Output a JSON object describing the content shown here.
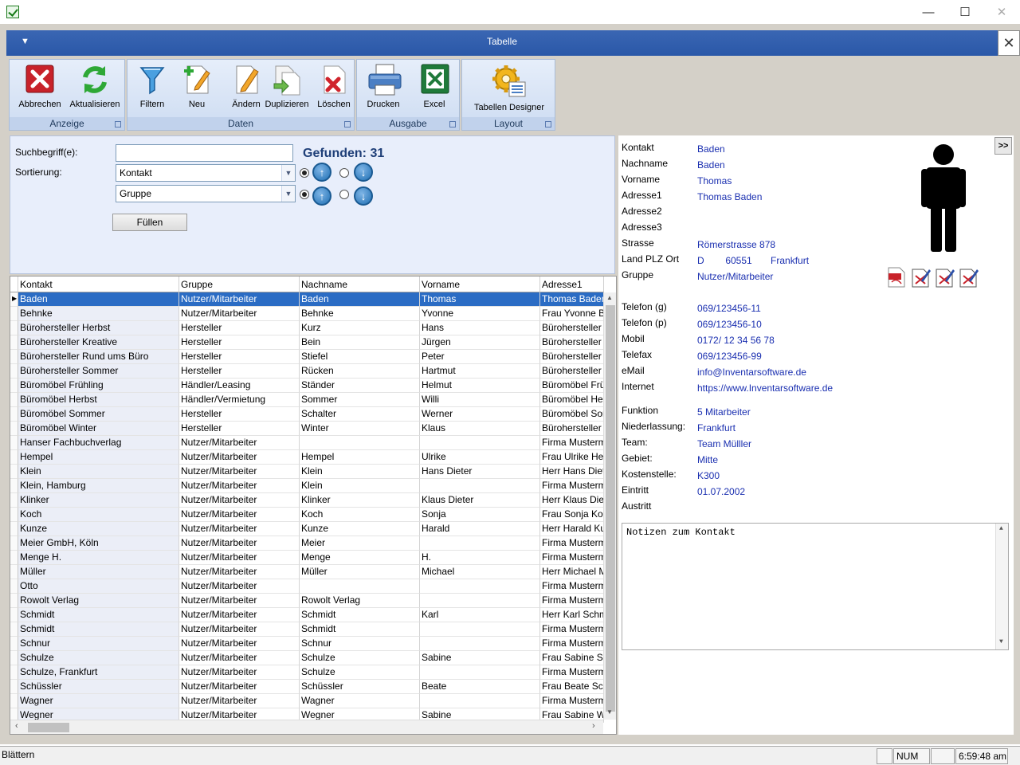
{
  "window": {
    "minimize": "—",
    "maximize": "☐",
    "close": "✕"
  },
  "inner": {
    "title": "Tabelle",
    "menu_glyph": "▼",
    "close_glyph": "✕"
  },
  "ribbon": {
    "buttons": {
      "abbrechen": "Abbrechen",
      "aktualisieren": "Aktualisieren",
      "filtern": "Filtern",
      "neu": "Neu",
      "aendern": "Ändern",
      "duplizieren": "Duplizieren",
      "loeschen": "Löschen",
      "drucken": "Drucken",
      "excel": "Excel",
      "designer": "Tabellen Designer"
    },
    "groups": {
      "anzeige": "Anzeige",
      "daten": "Daten",
      "ausgabe": "Ausgabe",
      "layout": "Layout"
    }
  },
  "search": {
    "label_search": "Suchbegriff(e):",
    "label_sort": "Sortierung:",
    "search_value": "",
    "sort1": "Kontakt",
    "sort2": "Gruppe",
    "found": "Gefunden: 31",
    "fill_button": "Füllen"
  },
  "grid": {
    "columns": [
      "Kontakt",
      "Gruppe",
      "Nachname",
      "Vorname",
      "Adresse1"
    ],
    "rows": [
      [
        "Baden",
        "Nutzer/Mitarbeiter",
        "Baden",
        "Thomas",
        "Thomas Baden"
      ],
      [
        "Behnke",
        "Nutzer/Mitarbeiter",
        "Behnke",
        "Yvonne",
        "Frau Yvonne Behnke"
      ],
      [
        "Bürohersteller Herbst",
        "Hersteller",
        "Kurz",
        "Hans",
        "Bürohersteller Herbst"
      ],
      [
        "Bürohersteller Kreative",
        "Hersteller",
        "Bein",
        "Jürgen",
        "Bürohersteller Kreative"
      ],
      [
        "Bürohersteller Rund ums Büro",
        "Hersteller",
        "Stiefel",
        "Peter",
        "Bürohersteller Rund ums Büro"
      ],
      [
        "Bürohersteller Sommer",
        "Hersteller",
        "Rücken",
        "Hartmut",
        "Bürohersteller Sommer"
      ],
      [
        "Büromöbel Frühling",
        "Händler/Leasing",
        "Ständer",
        "Helmut",
        "Büromöbel Frühling"
      ],
      [
        "Büromöbel Herbst",
        "Händler/Vermietung",
        "Sommer",
        "Willi",
        "Büromöbel Herbst"
      ],
      [
        "Büromöbel Sommer",
        "Hersteller",
        "Schalter",
        "Werner",
        "Büromöbel Sommer"
      ],
      [
        "Büromöbel Winter",
        "Hersteller",
        "Winter",
        "Klaus",
        "Bürohersteller Winter"
      ],
      [
        "Hanser Fachbuchverlag",
        "Nutzer/Mitarbeiter",
        "",
        "",
        "Firma Mustermann"
      ],
      [
        "Hempel",
        "Nutzer/Mitarbeiter",
        "Hempel",
        "Ulrike",
        "Frau Ulrike Hempel"
      ],
      [
        "Klein",
        "Nutzer/Mitarbeiter",
        "Klein",
        "Hans Dieter",
        "Herr Hans Dieter Klein"
      ],
      [
        "Klein, Hamburg",
        "Nutzer/Mitarbeiter",
        "Klein",
        "",
        "Firma Mustermann"
      ],
      [
        "Klinker",
        "Nutzer/Mitarbeiter",
        "Klinker",
        "Klaus Dieter",
        "Herr Klaus Dieter Klinker"
      ],
      [
        "Koch",
        "Nutzer/Mitarbeiter",
        "Koch",
        "Sonja",
        "Frau Sonja Koch"
      ],
      [
        "Kunze",
        "Nutzer/Mitarbeiter",
        "Kunze",
        "Harald",
        "Herr Harald Kunze"
      ],
      [
        "Meier GmbH, Köln",
        "Nutzer/Mitarbeiter",
        "Meier",
        "",
        "Firma Mustermann"
      ],
      [
        "Menge H.",
        "Nutzer/Mitarbeiter",
        "Menge",
        "H.",
        "Firma Mustermann"
      ],
      [
        "Müller",
        "Nutzer/Mitarbeiter",
        "Müller",
        "Michael",
        "Herr Michael Müller"
      ],
      [
        "Otto",
        "Nutzer/Mitarbeiter",
        "",
        "",
        "Firma Mustermann"
      ],
      [
        "Rowolt Verlag",
        "Nutzer/Mitarbeiter",
        "Rowolt Verlag",
        "",
        "Firma Mustermann"
      ],
      [
        "Schmidt",
        "Nutzer/Mitarbeiter",
        "Schmidt",
        "Karl",
        "Herr Karl Schmidt"
      ],
      [
        "Schmidt",
        "Nutzer/Mitarbeiter",
        "Schmidt",
        "",
        "Firma Mustermann"
      ],
      [
        "Schnur",
        "Nutzer/Mitarbeiter",
        "Schnur",
        "",
        "Firma Mustermann"
      ],
      [
        "Schulze",
        "Nutzer/Mitarbeiter",
        "Schulze",
        "Sabine",
        "Frau Sabine Schulze"
      ],
      [
        "Schulze, Frankfurt",
        "Nutzer/Mitarbeiter",
        "Schulze",
        "",
        "Firma Mustermann"
      ],
      [
        "Schüssler",
        "Nutzer/Mitarbeiter",
        "Schüssler",
        "Beate",
        "Frau Beate Schüssler"
      ],
      [
        "Wagner",
        "Nutzer/Mitarbeiter",
        "Wagner",
        "",
        "Firma Mustermann"
      ],
      [
        "Wegner",
        "Nutzer/Mitarbeiter",
        "Wegner",
        "Sabine",
        "Frau Sabine Wegner"
      ]
    ],
    "selected_row": 0
  },
  "detail": {
    "toggle": ">>",
    "fields": [
      {
        "label": "Kontakt",
        "value": "Baden"
      },
      {
        "label": "Nachname",
        "value": "Baden"
      },
      {
        "label": "Vorname",
        "value": "Thomas"
      },
      {
        "label": "Adresse1",
        "value": "Thomas Baden"
      },
      {
        "label": "Adresse2",
        "value": ""
      },
      {
        "label": "Adresse3",
        "value": ""
      },
      {
        "label": "Strasse",
        "value": "Römerstrasse 878"
      },
      {
        "label": "Land  PLZ  Ort",
        "value": "D        60551       Frankfurt"
      },
      {
        "label": "Gruppe",
        "value": "Nutzer/Mitarbeiter"
      },
      {
        "label": "Telefon (g)",
        "value": "069/123456-11"
      },
      {
        "label": "Telefon (p)",
        "value": "069/123456-10"
      },
      {
        "label": "Mobil",
        "value": "0172/ 12 34 56 78"
      },
      {
        "label": "Telefax",
        "value": "069/123456-99"
      },
      {
        "label": "eMail",
        "value": "info@Inventarsoftware.de"
      },
      {
        "label": "Internet",
        "value": "https://www.Inventarsoftware.de"
      },
      {
        "label": "Funktion",
        "value": "5 Mitarbeiter"
      },
      {
        "label": "Niederlassung:",
        "value": "Frankfurt"
      },
      {
        "label": "Team:",
        "value": "Team Mülller"
      },
      {
        "label": "Gebiet:",
        "value": "Mitte"
      },
      {
        "label": "Kostenstelle:",
        "value": "K300"
      },
      {
        "label": "Eintritt",
        "value": "01.07.2002"
      },
      {
        "label": "Austritt",
        "value": ""
      }
    ],
    "notes": "Notizen zum Kontakt"
  },
  "statusbar": {
    "text": "Blättern",
    "num": "NUM",
    "time": "6:59:48 am"
  },
  "colors": {
    "accent": "#2b6cc4",
    "link": "#1a2fb0",
    "ribbon": "#cddcf2"
  }
}
